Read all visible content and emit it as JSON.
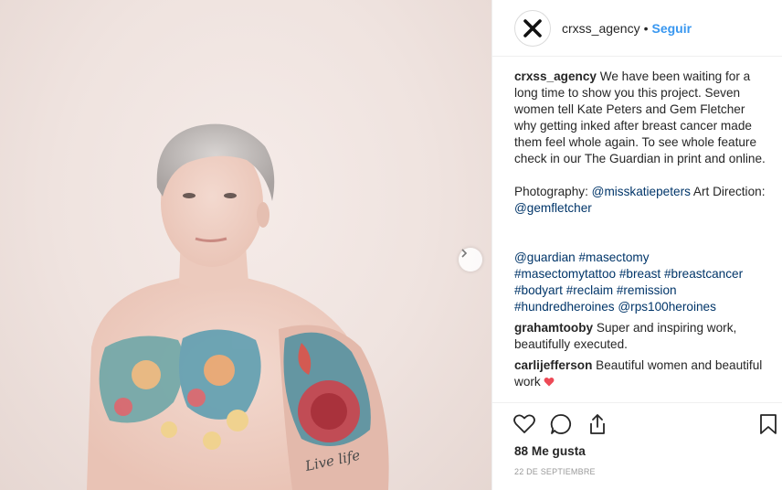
{
  "post": {
    "username": "crxss_agency",
    "dot": "•",
    "follow_label": "Seguir",
    "caption_text": "We have been waiting for a long time to show you this project. Seven women tell Kate Peters and Gem Fletcher why getting inked after breast cancer made them feel whole again. To see whole feature check in our The Guardian in print and online.",
    "credits_prefix": "Photography: ",
    "credits_mention1": "@misskatiepeters",
    "credits_middle": " Art Direction: ",
    "credits_mention2": "@gemfletcher",
    "hashtags": [
      "@guardian",
      "#masectomy",
      "#masectomytattoo",
      "#breast",
      "#breastcancer",
      "#bodyart",
      "#reclaim",
      "#remission",
      "#hundredheroines",
      "@rps100heroines"
    ]
  },
  "comments": [
    {
      "user": "grahamtooby",
      "text": "Super and inspiring work, beautifully executed."
    },
    {
      "user": "carlijefferson",
      "text": "Beautiful women and beautiful work"
    }
  ],
  "actions": {
    "likes_label": "88 Me gusta",
    "date_label": "22 de septiembre"
  },
  "icons": {
    "avatar": "x-logo-icon",
    "next": "chevron-right-icon",
    "like": "heart-icon",
    "comment": "comment-bubble-icon",
    "share": "share-icon",
    "save": "bookmark-icon"
  },
  "colors": {
    "link": "#003569",
    "follow": "#3897f0",
    "heart_emoji": "#ed4956"
  }
}
